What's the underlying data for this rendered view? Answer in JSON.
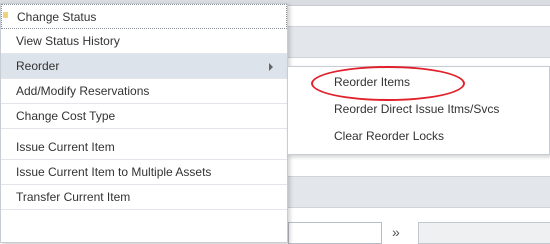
{
  "context_menu": {
    "items": [
      {
        "label": "Change Status"
      },
      {
        "label": "View Status History"
      },
      {
        "label": "Reorder"
      },
      {
        "label": "Add/Modify Reservations"
      },
      {
        "label": "Change Cost Type"
      },
      {
        "label": "Issue Current Item"
      },
      {
        "label": "Issue Current Item to Multiple Assets"
      },
      {
        "label": "Transfer Current Item"
      }
    ]
  },
  "submenu": {
    "items": [
      {
        "label": "Reorder Items"
      },
      {
        "label": "Reorder Direct Issue Itms/Svcs"
      },
      {
        "label": "Clear Reorder Locks"
      }
    ]
  },
  "background": {
    "chevron": "»"
  },
  "colors": {
    "highlight_ring": "#e0202a",
    "active_row": "#dde3ea"
  }
}
